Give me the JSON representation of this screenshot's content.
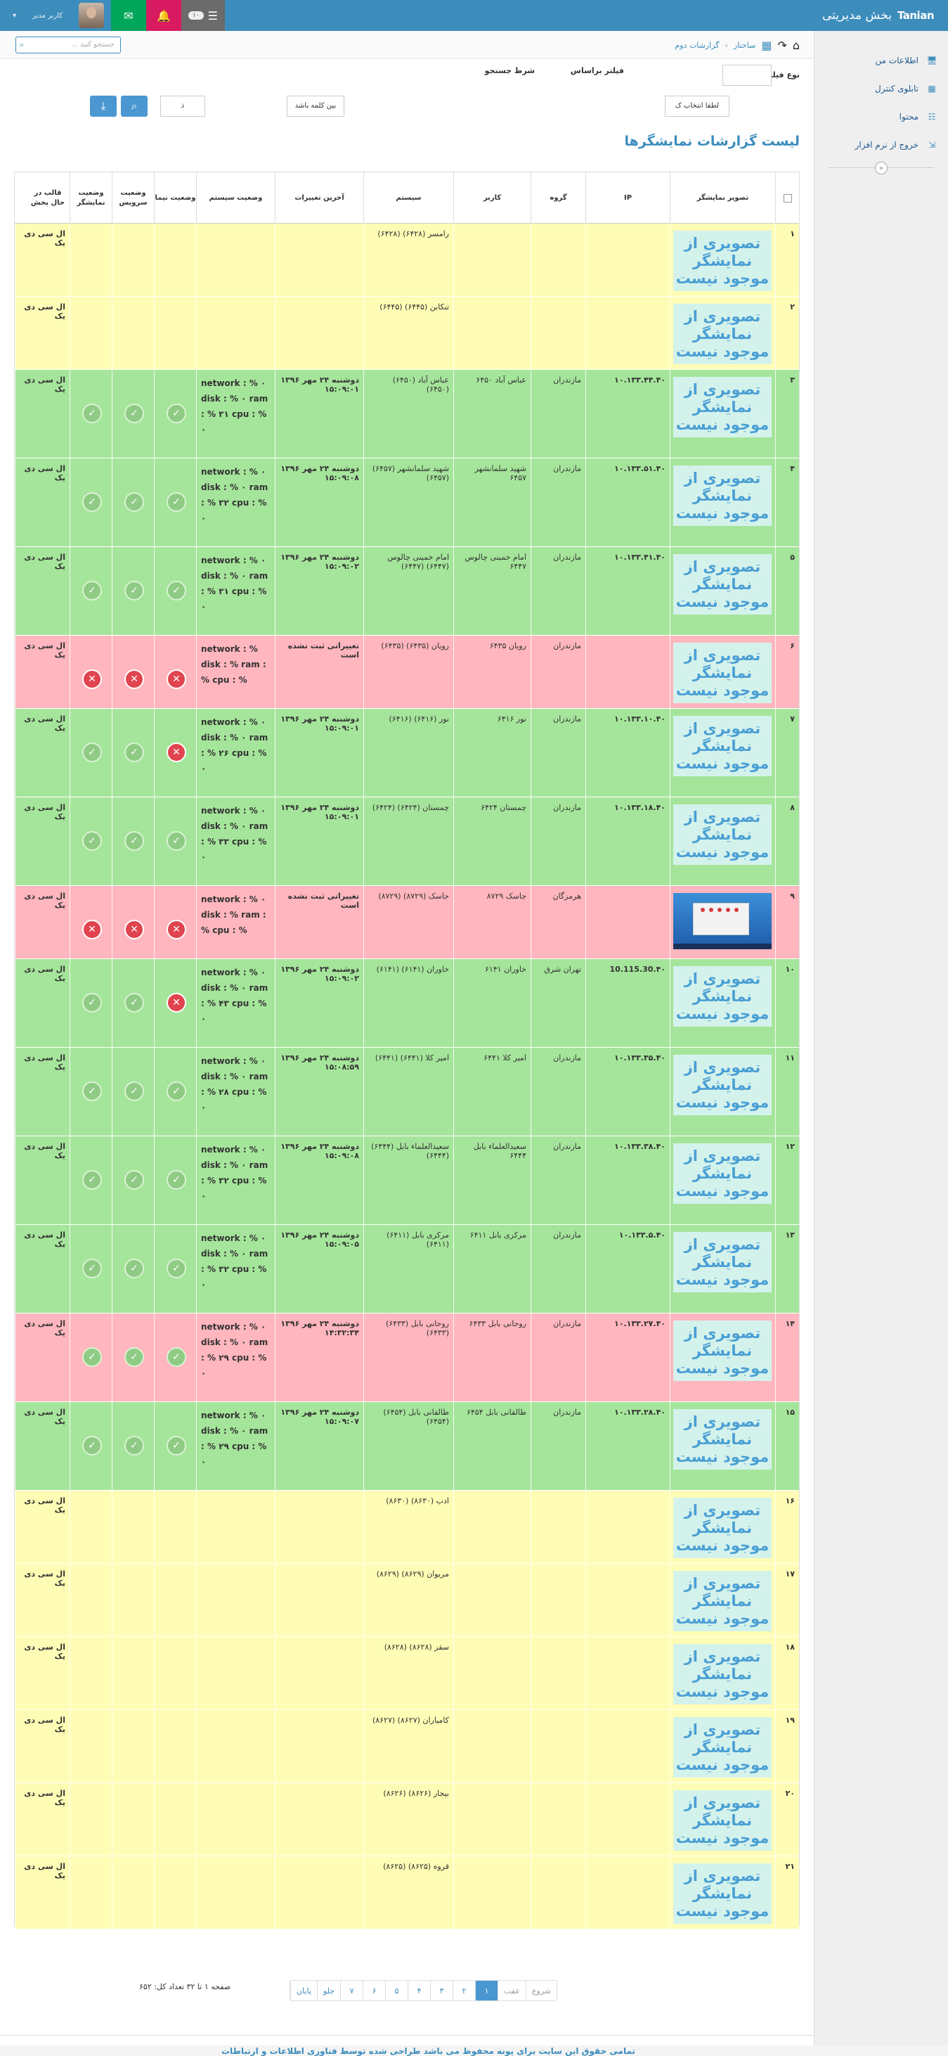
{
  "brand": {
    "logo": "Tanian",
    "title": "بخش مدیریتی"
  },
  "topbar": {
    "user_name": "کاربر مدیر",
    "tasks_count": "۱۰"
  },
  "sidebar": {
    "items": [
      {
        "label": "اطلاعات من",
        "icon": "monitor-icon"
      },
      {
        "label": "تابلوی کنترل",
        "icon": "building-icon"
      },
      {
        "label": "محتوا",
        "icon": "list-icon"
      },
      {
        "label": "خروج از نرم افزار",
        "icon": "exit-icon"
      }
    ]
  },
  "search": {
    "placeholder": "جستجو کنید ..."
  },
  "breadcrumb": {
    "level1": "ساختار",
    "level2": "گزارشات دوم"
  },
  "filters": {
    "type_label": "نوع فیلتر",
    "type_value": "لطفا انتخاب ک",
    "based_on_label": "فیلتر براساس",
    "based_on_value": "بین کلمه باشد",
    "condition_label": "شرط جستجو",
    "condition_value": "ذ"
  },
  "page_title": "لیست گزارشات نمایشگرها",
  "columns": [
    "تصویر نمایشگر",
    "IP",
    "گروه",
    "کاربر",
    "سیستم",
    "آخرین تغییرات",
    "وضعیت سیستم",
    "وضعیت نیما",
    "وضعیت سرویس",
    "وضعیت نمایشگر",
    "قالب در حال پخش"
  ],
  "no_image_text": "تصویری از نمایشگر موجود نیست",
  "rows": [
    {
      "n": "۱",
      "color": "yellow",
      "img": "none",
      "ip": "",
      "group": "",
      "user": "",
      "system": "رامسر (۶۴۲۸) (۶۴۲۸)",
      "changed": "",
      "status": "",
      "nima": "",
      "service": "",
      "display": "",
      "template": "ال سی دی یک"
    },
    {
      "n": "۲",
      "color": "yellow",
      "img": "none",
      "ip": "",
      "group": "",
      "user": "",
      "system": "تنکابن (۶۴۴۵) (۶۴۴۵)",
      "changed": "",
      "status": "",
      "nima": "",
      "service": "",
      "display": "",
      "template": "ال سی دی یک"
    },
    {
      "n": "۳",
      "color": "green",
      "img": "none",
      "ip": "۱۰.۱۳۳.۴۴.۴۰",
      "group": "مازندران",
      "user": "عباس آباد ۶۴۵۰",
      "system": "عباس آباد (۶۴۵۰) (۶۴۵۰)",
      "changed": "دوشنبه ۲۴ مهر ۱۳۹۶ ۱۵:۰۹:۰۱",
      "status": "network : % ۰ disk : % ۰ ram : % ۳۱ cpu : % ۰",
      "nima": "ok",
      "service": "ok",
      "display": "ok",
      "template": "ال سی دی یک"
    },
    {
      "n": "۴",
      "color": "green",
      "img": "none",
      "ip": "۱۰.۱۳۳.۵۱.۴۰",
      "group": "مازندران",
      "user": "شهید سلمانشهر ۶۴۵۷",
      "system": "شهید سلمانشهر (۶۴۵۷) (۶۴۵۷)",
      "changed": "دوشنبه ۲۴ مهر ۱۳۹۶ ۱۵:۰۹:۰۸",
      "status": "network : % ۰ disk : % ۰ ram : % ۳۲ cpu : % ۰",
      "nima": "ok",
      "service": "ok",
      "display": "ok",
      "template": "ال سی دی یک"
    },
    {
      "n": "۵",
      "color": "green",
      "img": "none",
      "ip": "۱۰.۱۳۳.۴۱.۴۰",
      "group": "مازندران",
      "user": "امام خمینی چالوس ۶۴۴۷",
      "system": "امام خمینی چالوس (۶۴۴۷) (۶۴۴۷)",
      "changed": "دوشنبه ۲۴ مهر ۱۳۹۶ ۱۵:۰۹:۰۲",
      "status": "network : % ۰ disk : % ۰ ram : % ۳۱ cpu : % ۰",
      "nima": "ok",
      "service": "ok",
      "display": "ok",
      "template": "ال سی دی یک"
    },
    {
      "n": "۶",
      "color": "red",
      "img": "none",
      "ip": "",
      "group": "مازندران",
      "user": "رویان ۶۴۳۵",
      "system": "رویان (۶۴۳۵) (۶۴۳۵)",
      "changed": "تغییراتی ثبت نشده است",
      "status": "network : % disk : % ram : % cpu : %",
      "nima": "bad",
      "service": "bad",
      "display": "bad",
      "template": "ال سی دی یک"
    },
    {
      "n": "۷",
      "color": "green",
      "img": "none",
      "ip": "۱۰.۱۳۳.۱۰.۴۰",
      "group": "مازندران",
      "user": "نور ۶۴۱۶",
      "system": "نور (۶۴۱۶) (۶۴۱۶)",
      "changed": "دوشنبه ۲۴ مهر ۱۳۹۶ ۱۵:۰۹:۰۱",
      "status": "network : % ۰ disk : % ۰ ram : % ۲۶ cpu : % ۰",
      "nima": "bad",
      "service": "ok",
      "display": "ok",
      "template": "ال سی دی یک"
    },
    {
      "n": "۸",
      "color": "green",
      "img": "none",
      "ip": "۱۰.۱۳۳.۱۸.۴۰",
      "group": "مازندران",
      "user": "چمستان ۶۴۲۴",
      "system": "چمستان (۶۴۲۴) (۶۴۲۴)",
      "changed": "دوشنبه ۲۴ مهر ۱۳۹۶ ۱۵:۰۹:۰۱",
      "status": "network : % ۰ disk : % ۰ ram : % ۳۳ cpu : % ۰",
      "nima": "ok",
      "service": "ok",
      "display": "ok",
      "template": "ال سی دی یک"
    },
    {
      "n": "۹",
      "color": "red",
      "img": "screenshot",
      "ip": "",
      "group": "هرمزگان",
      "user": "جاسک ۸۷۲۹",
      "system": "جاسک (۸۷۲۹) (۸۷۲۹)",
      "changed": "تغییراتی ثبت نشده است",
      "status": "network : % ۰ disk : % ram : % cpu : %",
      "nima": "bad",
      "service": "bad",
      "display": "bad",
      "template": "ال سی دی یک"
    },
    {
      "n": "۱۰",
      "color": "green",
      "img": "none",
      "ip": "10.115.30.۴۰",
      "group": "تهران شرق",
      "user": "خاوران ۶۱۴۱",
      "system": "خاوران (۶۱۴۱) (۶۱۴۱)",
      "changed": "دوشنبه ۲۴ مهر ۱۳۹۶ ۱۵:۰۹:۰۲",
      "status": "network : % ۰ disk : % ۰ ram : % ۴۳ cpu : % ۰",
      "nima": "bad",
      "service": "ok",
      "display": "ok",
      "template": "ال سی دی یک"
    },
    {
      "n": "۱۱",
      "color": "green",
      "img": "none",
      "ip": "۱۰.۱۳۳.۳۵.۴۰",
      "group": "مازندران",
      "user": "امیر کلا ۶۴۴۱",
      "system": "امیر کلا (۶۴۴۱) (۶۴۴۱)",
      "changed": "دوشنبه ۲۴ مهر ۱۳۹۶ ۱۵:۰۸:۵۹",
      "status": "network : % ۰ disk : % ۰ ram : % ۲۸ cpu : % ۰",
      "nima": "ok",
      "service": "ok",
      "display": "ok",
      "template": "ال سی دی یک"
    },
    {
      "n": "۱۲",
      "color": "green",
      "img": "none",
      "ip": "۱۰.۱۳۳.۳۸.۴۰",
      "group": "مازندران",
      "user": "سعیدالعلماء بابل ۶۴۴۴",
      "system": "سعیدالعلماء بابل (۶۴۴۴) (۶۴۴۴)",
      "changed": "دوشنبه ۲۴ مهر ۱۳۹۶ ۱۵:۰۹:۰۸",
      "status": "network : % ۰ disk : % ۰ ram : % ۳۲ cpu : % ۰",
      "nima": "ok",
      "service": "ok",
      "display": "ok",
      "template": "ال سی دی یک"
    },
    {
      "n": "۱۳",
      "color": "green",
      "img": "none",
      "ip": "۱۰.۱۳۳.۵.۴۰",
      "group": "مازندران",
      "user": "مرکزی بابل ۶۴۱۱",
      "system": "مرکزی بابل (۶۴۱۱) (۶۴۱۱)",
      "changed": "دوشنبه ۲۴ مهر ۱۳۹۶ ۱۵:۰۹:۰۵",
      "status": "network : % ۰ disk : % ۰ ram : % ۳۲ cpu : % ۰",
      "nima": "ok",
      "service": "ok",
      "display": "ok",
      "template": "ال سی دی یک"
    },
    {
      "n": "۱۴",
      "color": "red",
      "img": "none",
      "ip": "۱۰.۱۳۳.۲۷.۴۰",
      "group": "مازندران",
      "user": "روحانی بابل ۶۴۳۳",
      "system": "روحانی بابل (۶۴۳۳) (۶۴۳۳)",
      "changed": "دوشنبه ۲۴ مهر ۱۳۹۶ ۱۴:۳۲:۳۴",
      "status": "network : % ۰ disk : % ۰ ram : % ۲۹ cpu : % ۰",
      "nima": "ok",
      "service": "ok",
      "display": "ok",
      "template": "ال سی دی یک"
    },
    {
      "n": "۱۵",
      "color": "green",
      "img": "none",
      "ip": "۱۰.۱۳۳.۲۸.۴۰",
      "group": "مازندران",
      "user": "طالقانی بابل ۶۴۵۴",
      "system": "طالقانی بابل (۶۴۵۴) (۶۴۵۴)",
      "changed": "دوشنبه ۲۴ مهر ۱۳۹۶ ۱۵:۰۹:۰۷",
      "status": "network : % ۰ disk : % ۰ ram : % ۲۹ cpu : % ۰",
      "nima": "ok",
      "service": "ok",
      "display": "ok",
      "template": "ال سی دی یک"
    },
    {
      "n": "۱۶",
      "color": "yellow",
      "img": "none",
      "ip": "",
      "group": "",
      "user": "",
      "system": "ادب (۸۶۳۰) (۸۶۳۰)",
      "changed": "",
      "status": "",
      "nima": "",
      "service": "",
      "display": "",
      "template": "ال سی دی یک"
    },
    {
      "n": "۱۷",
      "color": "yellow",
      "img": "none",
      "ip": "",
      "group": "",
      "user": "",
      "system": "مریوان (۸۶۲۹) (۸۶۲۹)",
      "changed": "",
      "status": "",
      "nima": "",
      "service": "",
      "display": "",
      "template": "ال سی دی یک"
    },
    {
      "n": "۱۸",
      "color": "yellow",
      "img": "none",
      "ip": "",
      "group": "",
      "user": "",
      "system": "سقز (۸۶۲۸) (۸۶۲۸)",
      "changed": "",
      "status": "",
      "nima": "",
      "service": "",
      "display": "",
      "template": "ال سی دی یک"
    },
    {
      "n": "۱۹",
      "color": "yellow",
      "img": "none",
      "ip": "",
      "group": "",
      "user": "",
      "system": "کامیاران (۸۶۲۷) (۸۶۲۷)",
      "changed": "",
      "status": "",
      "nima": "",
      "service": "",
      "display": "",
      "template": "ال سی دی یک"
    },
    {
      "n": "۲۰",
      "color": "yellow",
      "img": "none",
      "ip": "",
      "group": "",
      "user": "",
      "system": "بیجار (۸۶۲۶) (۸۶۲۶)",
      "changed": "",
      "status": "",
      "nima": "",
      "service": "",
      "display": "",
      "template": "ال سی دی یک"
    },
    {
      "n": "۲۱",
      "color": "yellow",
      "img": "none",
      "ip": "",
      "group": "",
      "user": "",
      "system": "قروه (۸۶۲۵) (۸۶۲۵)",
      "changed": "",
      "status": "",
      "nima": "",
      "service": "",
      "display": "",
      "template": "ال سی دی یک"
    }
  ],
  "pagination": {
    "pages": [
      "شروع",
      "عقب",
      "۱",
      "۲",
      "۳",
      "۴",
      "۵",
      "۶",
      "۷",
      "جلو",
      "پایان"
    ],
    "active": "۱",
    "info": "صفحه ۱ تا ۳۲    تعداد کل: ۶۵۲"
  },
  "footer": {
    "text": "تمامی حقوق این سایت برای پونه محفوظ می باشد    طراحی شده توسط فناوری اطلاعات و ارتباطات"
  }
}
